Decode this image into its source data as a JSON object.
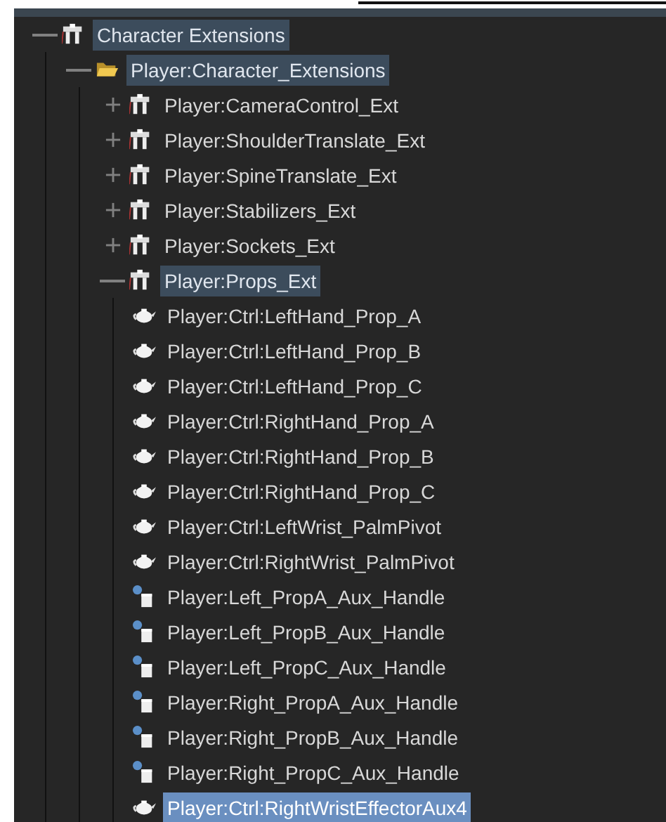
{
  "tree": [
    {
      "label": "Character Extensions",
      "kind": "character",
      "expanded": true,
      "highlighted": true,
      "selected": false,
      "children": [
        {
          "label": "Player:Character_Extensions",
          "kind": "folder",
          "expanded": true,
          "highlighted": true,
          "selected": false,
          "children": [
            {
              "label": "Player:CameraControl_Ext",
              "kind": "character",
              "expanded": false,
              "highlighted": false,
              "selected": false
            },
            {
              "label": "Player:ShoulderTranslate_Ext",
              "kind": "character",
              "expanded": false,
              "highlighted": false,
              "selected": false
            },
            {
              "label": "Player:SpineTranslate_Ext",
              "kind": "character",
              "expanded": false,
              "highlighted": false,
              "selected": false
            },
            {
              "label": "Player:Stabilizers_Ext",
              "kind": "character",
              "expanded": false,
              "highlighted": false,
              "selected": false
            },
            {
              "label": "Player:Sockets_Ext",
              "kind": "character",
              "expanded": false,
              "highlighted": false,
              "selected": false
            },
            {
              "label": "Player:Props_Ext",
              "kind": "character",
              "expanded": true,
              "highlighted": true,
              "selected": false,
              "children": [
                {
                  "label": "Player:Ctrl:LeftHand_Prop_A",
                  "kind": "teapot",
                  "highlighted": false,
                  "selected": false
                },
                {
                  "label": "Player:Ctrl:LeftHand_Prop_B",
                  "kind": "teapot",
                  "highlighted": false,
                  "selected": false
                },
                {
                  "label": "Player:Ctrl:LeftHand_Prop_C",
                  "kind": "teapot",
                  "highlighted": false,
                  "selected": false
                },
                {
                  "label": "Player:Ctrl:RightHand_Prop_A",
                  "kind": "teapot",
                  "highlighted": false,
                  "selected": false
                },
                {
                  "label": "Player:Ctrl:RightHand_Prop_B",
                  "kind": "teapot",
                  "highlighted": false,
                  "selected": false
                },
                {
                  "label": "Player:Ctrl:RightHand_Prop_C",
                  "kind": "teapot",
                  "highlighted": false,
                  "selected": false
                },
                {
                  "label": "Player:Ctrl:LeftWrist_PalmPivot",
                  "kind": "teapot",
                  "highlighted": false,
                  "selected": false
                },
                {
                  "label": "Player:Ctrl:RightWrist_PalmPivot",
                  "kind": "teapot",
                  "highlighted": false,
                  "selected": false
                },
                {
                  "label": "Player:Left_PropA_Aux_Handle",
                  "kind": "handle",
                  "highlighted": false,
                  "selected": false
                },
                {
                  "label": "Player:Left_PropB_Aux_Handle",
                  "kind": "handle",
                  "highlighted": false,
                  "selected": false
                },
                {
                  "label": "Player:Left_PropC_Aux_Handle",
                  "kind": "handle",
                  "highlighted": false,
                  "selected": false
                },
                {
                  "label": "Player:Right_PropA_Aux_Handle",
                  "kind": "handle",
                  "highlighted": false,
                  "selected": false
                },
                {
                  "label": "Player:Right_PropB_Aux_Handle",
                  "kind": "handle",
                  "highlighted": false,
                  "selected": false
                },
                {
                  "label": "Player:Right_PropC_Aux_Handle",
                  "kind": "handle",
                  "highlighted": false,
                  "selected": false
                },
                {
                  "label": "Player:Ctrl:RightWristEffectorAux4",
                  "kind": "teapot",
                  "highlighted": false,
                  "selected": true
                }
              ]
            }
          ]
        }
      ]
    }
  ]
}
